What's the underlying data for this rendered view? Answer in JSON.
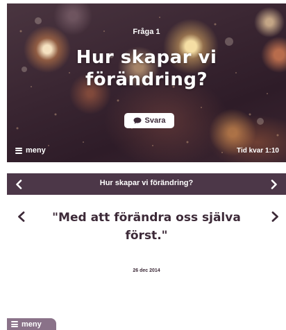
{
  "question_card": {
    "label": "Fråga 1",
    "title": "Hur skapar vi förändring?",
    "answer_button_label": "Svara",
    "menu_label": "meny",
    "timer_text": "Tid kvar 1:10"
  },
  "answer_card": {
    "header_title": "Hur skapar vi förändring?",
    "answer_text": "\"Med att förändra oss själva först.\"",
    "date": "26 dec 2014",
    "menu_label": "meny"
  },
  "colors": {
    "header_bg": "#4c3748",
    "text_dark": "#3d2a38",
    "menu_tab_bg": "#8a7289"
  }
}
